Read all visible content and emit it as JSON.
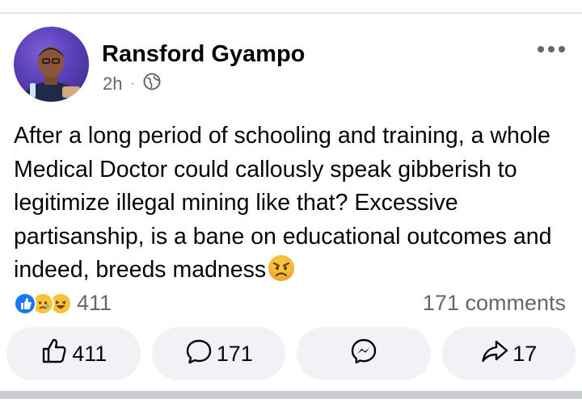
{
  "post": {
    "author": "Ransford Gyampo",
    "time": "2h",
    "separator": "·",
    "privacy_icon": "globe-icon",
    "text": "After a long period of schooling and training, a whole Medical Doctor could callously speak gibberish to legitimize illegal mining like that? Excessive partisanship, is a bane on educational outcomes and indeed, breeds madness",
    "trailing_emoji": "angry-face-emoji"
  },
  "stats": {
    "reaction_icons": [
      "like-reaction-icon",
      "sad-reaction-icon",
      "haha-reaction-icon"
    ],
    "reaction_count": "411",
    "comments_label": "171 comments"
  },
  "actions": {
    "like_count": "411",
    "comment_count": "171",
    "share_count": "17"
  },
  "colors": {
    "like_blue": "#1877f2",
    "reaction_yellow": "#f7c33a",
    "muted_text": "#65676b",
    "button_bg": "#f0f2f5"
  }
}
